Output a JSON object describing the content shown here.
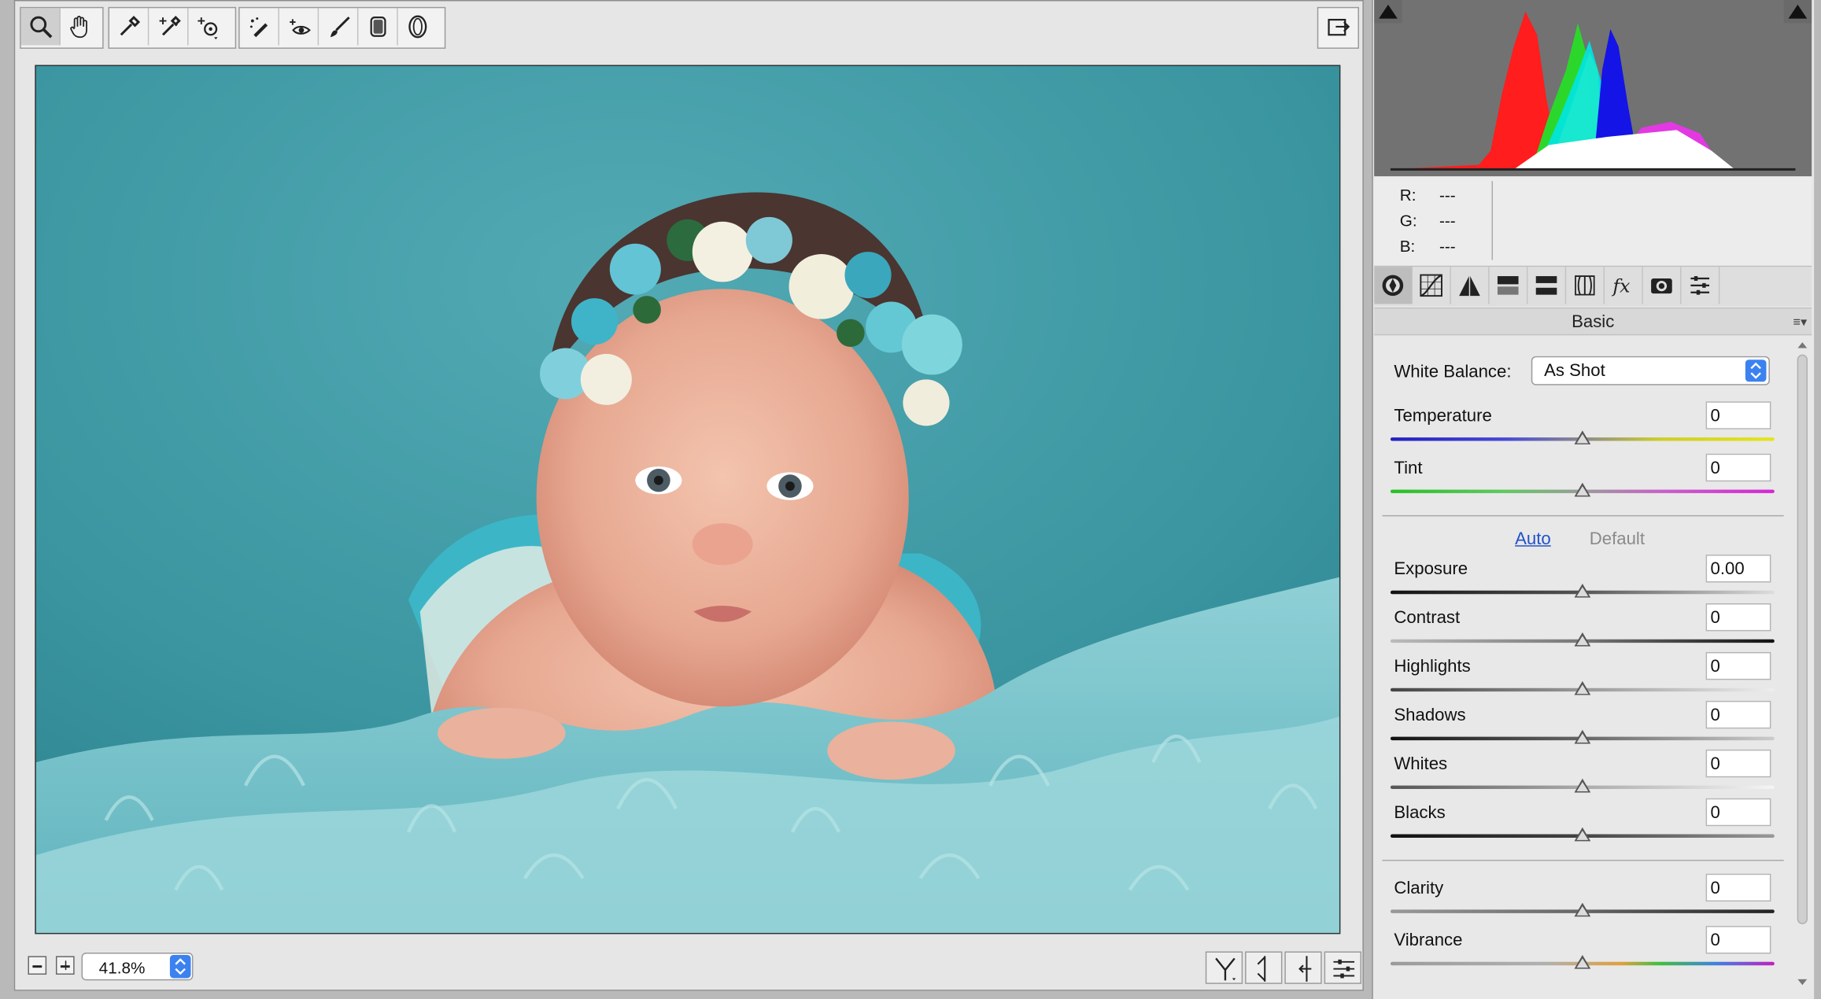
{
  "toolbar": {
    "tools": [
      "zoom-tool",
      "hand-tool",
      "white-balance-tool",
      "color-sampler-tool",
      "targeted-adjustment-tool",
      "spot-removal-tool",
      "red-eye-tool",
      "adjustment-brush-tool",
      "graduated-filter-tool",
      "radial-filter-tool"
    ],
    "active_tool": "zoom-tool"
  },
  "zoom": {
    "value": "41.8%"
  },
  "info": {
    "r_label": "R:",
    "g_label": "G:",
    "b_label": "B:",
    "r_value": "---",
    "g_value": "---",
    "b_value": "---"
  },
  "panel": {
    "title": "Basic",
    "white_balance_label": "White Balance:",
    "white_balance_value": "As Shot",
    "auto_label": "Auto",
    "default_label": "Default",
    "sliders": [
      {
        "label": "Temperature",
        "value": "0",
        "level": 0.5
      },
      {
        "label": "Tint",
        "value": "0",
        "level": 0.5
      },
      {
        "label": "Exposure",
        "value": "0.00",
        "level": 0.5
      },
      {
        "label": "Contrast",
        "value": "0",
        "level": 0.5
      },
      {
        "label": "Highlights",
        "value": "0",
        "level": 0.5
      },
      {
        "label": "Shadows",
        "value": "0",
        "level": 0.5
      },
      {
        "label": "Whites",
        "value": "0",
        "level": 0.5
      },
      {
        "label": "Blacks",
        "value": "0",
        "level": 0.5
      },
      {
        "label": "Clarity",
        "value": "0",
        "level": 0.5
      },
      {
        "label": "Vibrance",
        "value": "0",
        "level": 0.5
      }
    ]
  },
  "colors": {
    "accent": "#3b82f0",
    "photo_background": "#3b97a1"
  }
}
